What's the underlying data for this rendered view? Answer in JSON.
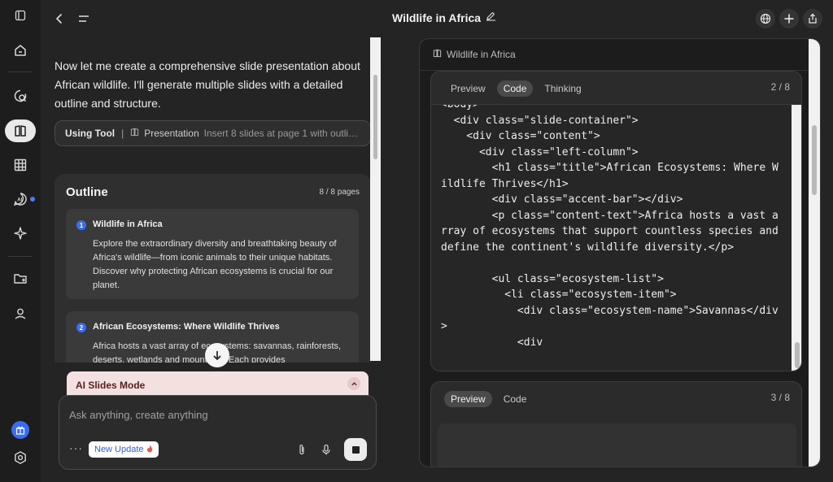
{
  "header": {
    "title": "Wildlife in Africa"
  },
  "chat": {
    "message": "Now let me create a comprehensive slide presentation about African wildlife. I'll generate multiple slides with a detailed outline and structure.",
    "tool": {
      "label": "Using Tool",
      "separator": "|",
      "name": "Presentation",
      "description": "Insert 8 slides at page 1 with outline ..."
    },
    "outline": {
      "heading": "Outline",
      "pages": "8 / 8 pages",
      "items": [
        {
          "number": "1",
          "title": "Wildlife in Africa",
          "description": "Explore the extraordinary diversity and breathtaking beauty of Africa's wildlife—from iconic animals to their unique habitats. Discover why protecting African ecosystems is crucial for our planet."
        },
        {
          "number": "2",
          "title": "African Ecosystems: Where Wildlife Thrives",
          "description": "Africa hosts a vast array of ecosystems: savannas, rainforests, deserts, wetlands and mountains. Each provides"
        }
      ]
    },
    "mode": {
      "label": "AI Slides Mode"
    },
    "composer": {
      "placeholder": "Ask anything, create anything",
      "more": "···",
      "update_label": "New Update"
    }
  },
  "panel": {
    "header": "Wildlife in Africa",
    "slide2": {
      "tabs": [
        "Preview",
        "Code",
        "Thinking"
      ],
      "active_tab": "Code",
      "page": "2 / 8",
      "code": "<body>\n  <div class=\"slide-container\">\n    <div class=\"content\">\n      <div class=\"left-column\">\n        <h1 class=\"title\">African Ecosystems: Where Wildlife Thrives</h1>\n        <div class=\"accent-bar\"></div>\n        <p class=\"content-text\">Africa hosts a vast array of ecosystems that support countless species and define the continent's wildlife diversity.</p>\n\n        <ul class=\"ecosystem-list\">\n          <li class=\"ecosystem-item\">\n            <div class=\"ecosystem-name\">Savannas</div>\n            <div"
    },
    "slide3": {
      "tabs": [
        "Preview",
        "Code"
      ],
      "active_tab": "Preview",
      "page": "3 / 8"
    }
  },
  "icons": {
    "rail": [
      "sidebar-toggle-icon",
      "home-icon",
      "search-chat-icon",
      "book-icon",
      "table-icon",
      "ai-chat-icon",
      "sparkle-icon",
      "folder-add-icon",
      "profile-icon",
      "gift-icon",
      "settings-icon"
    ],
    "accent": "#3a6cf0"
  }
}
